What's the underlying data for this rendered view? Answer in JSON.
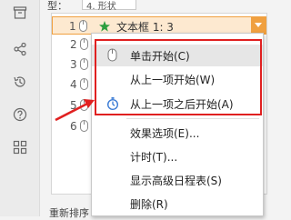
{
  "pane": {
    "top_label": "型：",
    "top_value": "4. 形状",
    "bottom_label": "重新排序"
  },
  "animation_list": {
    "rows": [
      {
        "num": "1",
        "label": "文本框 1: 3",
        "selected": true
      },
      {
        "num": "2"
      },
      {
        "num": "3"
      },
      {
        "num": "4"
      },
      {
        "num": "5"
      },
      {
        "num": "6"
      }
    ]
  },
  "context_menu": {
    "items": [
      {
        "label": "单击开始(C)",
        "icon": "mouse-click-icon",
        "hover": true
      },
      {
        "label": "从上一项开始(W)",
        "icon": ""
      },
      {
        "label": "从上一项之后开始(A)",
        "icon": "clock-icon"
      },
      {
        "label": "效果选项(E)...",
        "icon": ""
      },
      {
        "label": "计时(T)...",
        "icon": ""
      },
      {
        "label": "显示高级日程表(S)",
        "icon": ""
      },
      {
        "label": "删除(R)",
        "icon": ""
      }
    ]
  },
  "sidebar_icons": [
    "archive-icon",
    "share-icon",
    "history-icon",
    "help-icon",
    "apps-icon"
  ],
  "colors": {
    "highlight_border": "#e02020",
    "selection_orange": "#f0a040",
    "star_green": "#2e9e3e"
  }
}
